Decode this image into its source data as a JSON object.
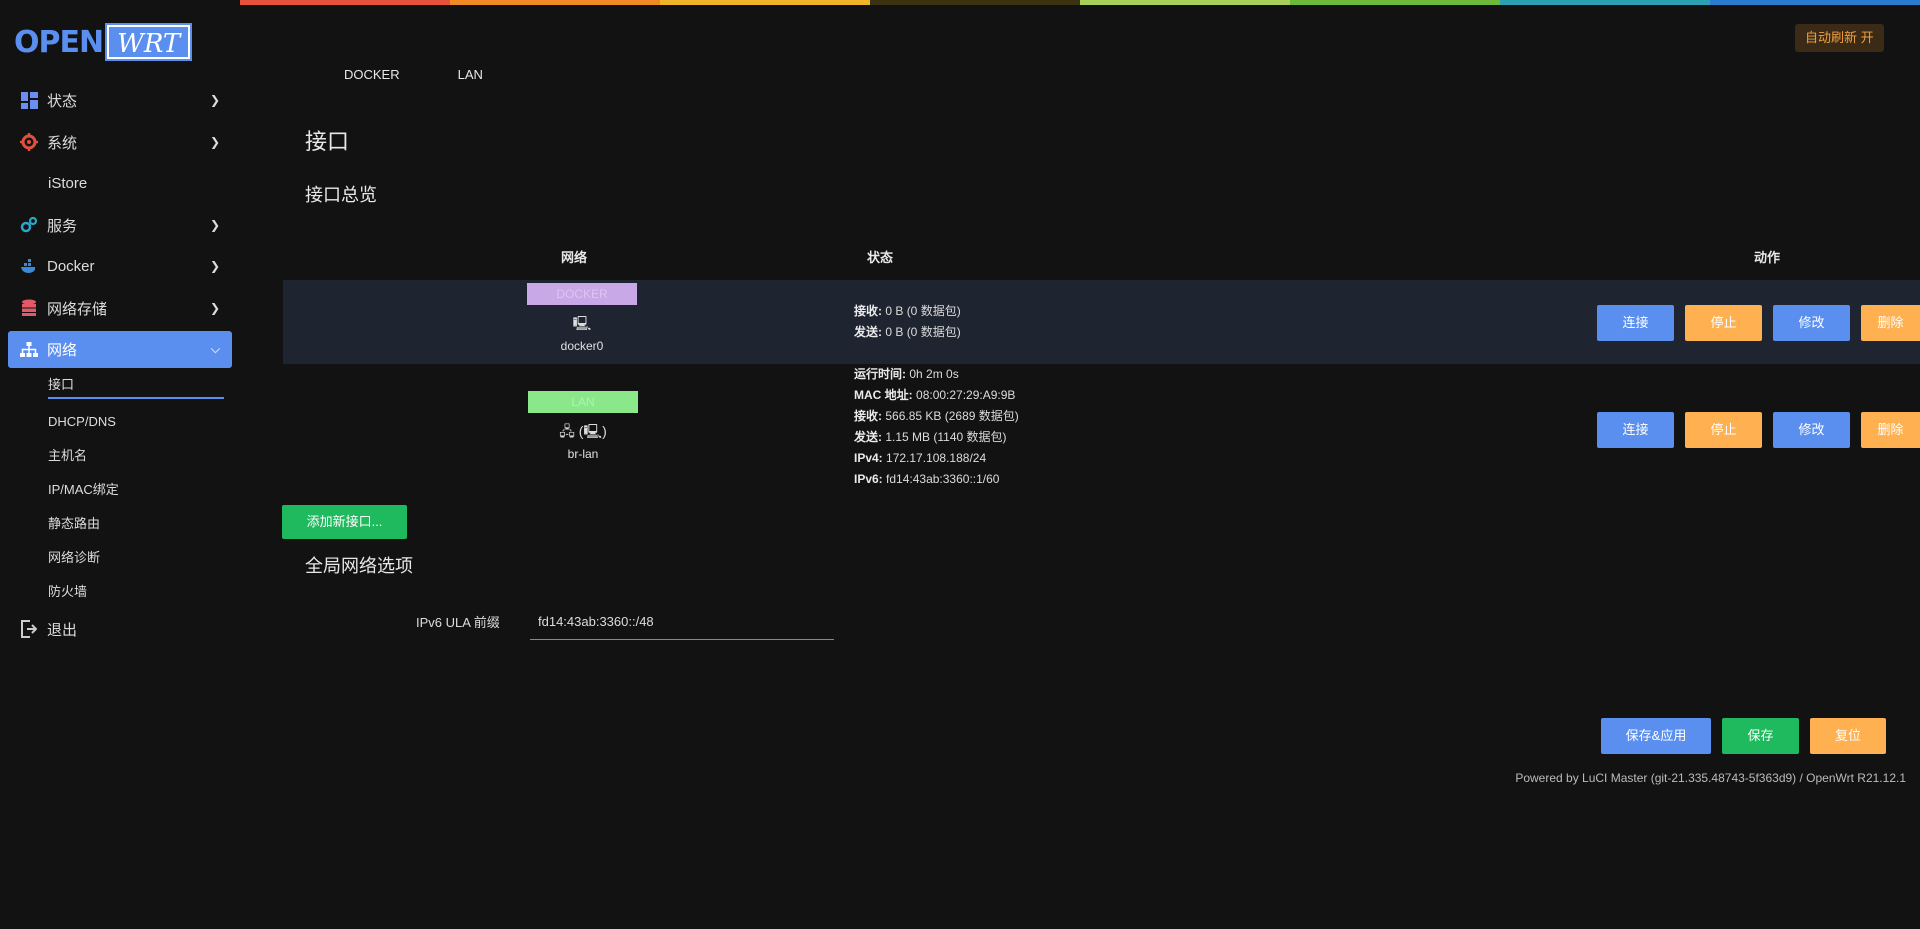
{
  "rainbow_colors": [
    "#e6533a",
    "#f08a24",
    "#f0b429",
    "#3a3210",
    "#a8d15a",
    "#6dba3a",
    "#2aa0b0",
    "#2a7ad0"
  ],
  "brand": {
    "open": "OPEN",
    "wrt": "WRT"
  },
  "auto_refresh": "自动刷新 开",
  "tabs": [
    "DOCKER",
    "LAN"
  ],
  "sidebar": {
    "items": [
      {
        "label": "状态",
        "icon": "dashboard-icon"
      },
      {
        "label": "系统",
        "icon": "gear-icon"
      },
      {
        "label": "iStore"
      },
      {
        "label": "服务",
        "icon": "cogs-icon"
      },
      {
        "label": "Docker",
        "icon": "docker-icon"
      },
      {
        "label": "网络存储",
        "icon": "database-icon"
      },
      {
        "label": "网络",
        "icon": "sitemap-icon"
      }
    ],
    "subitems": [
      "接口",
      "DHCP/DNS",
      "主机名",
      "IP/MAC绑定",
      "静态路由",
      "网络诊断",
      "防火墙"
    ],
    "logout": "退出"
  },
  "page_title": "接口",
  "section_title": "接口总览",
  "table": {
    "headers": {
      "network": "网络",
      "status": "状态",
      "actions": "动作"
    },
    "rows": [
      {
        "badge": "DOCKER",
        "badge_color": "#c9a8e8",
        "icon": "🖳",
        "device": "docker0",
        "status": [
          {
            "k": "接收:",
            "v": "0 B (0 数据包)"
          },
          {
            "k": "发送:",
            "v": "0 B (0 数据包)"
          }
        ]
      },
      {
        "badge": "LAN",
        "badge_color": "#8ae88a",
        "icon": "🖧 (🖳)",
        "device": "br-lan",
        "status": [
          {
            "k": "运行时间:",
            "v": "0h 2m 0s"
          },
          {
            "k": "MAC 地址:",
            "v": "08:00:27:29:A9:9B"
          },
          {
            "k": "接收:",
            "v": "566.85 KB (2689 数据包)"
          },
          {
            "k": "发送:",
            "v": "1.15 MB (1140 数据包)"
          },
          {
            "k": "IPv4:",
            "v": "172.17.108.188/24"
          },
          {
            "k": "IPv6:",
            "v": "fd14:43ab:3360::1/60"
          }
        ]
      }
    ],
    "buttons": {
      "connect": "连接",
      "stop": "停止",
      "edit": "修改",
      "delete": "删除"
    }
  },
  "add_interface": "添加新接口...",
  "global_title": "全局网络选项",
  "ula": {
    "label": "IPv6 ULA 前缀",
    "value": "fd14:43ab:3360::/48"
  },
  "footer_buttons": {
    "save_apply": "保存&应用",
    "save": "保存",
    "reset": "复位"
  },
  "footer": "Powered by LuCI Master (git-21.335.48743-5f363d9) / OpenWrt R21.12.1"
}
